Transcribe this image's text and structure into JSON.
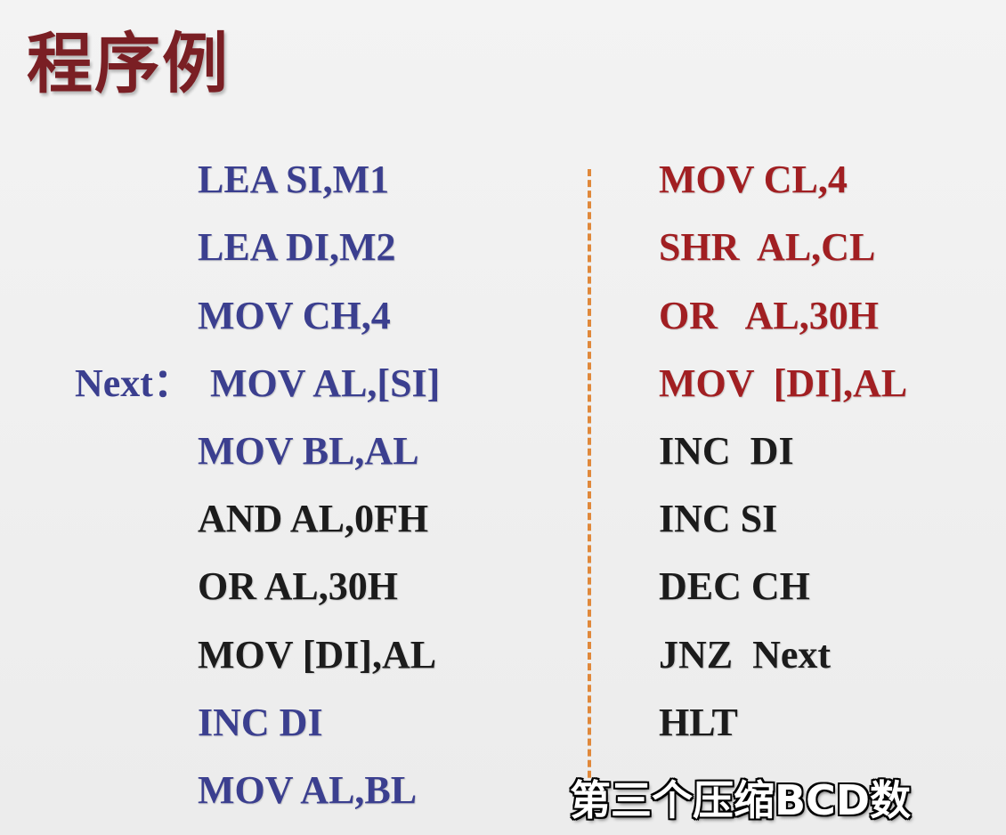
{
  "slide": {
    "title": "程序例",
    "left_column": [
      {
        "text": "LEA SI,M1",
        "color": "blue"
      },
      {
        "text": "LEA DI,M2",
        "color": "blue"
      },
      {
        "text": "MOV CH,4",
        "color": "blue"
      },
      {
        "text": "MOV AL,[SI]",
        "color": "blue"
      },
      {
        "text": "MOV BL,AL",
        "color": "blue"
      },
      {
        "text": "AND AL,0FH",
        "color": "black"
      },
      {
        "text": "OR AL,30H",
        "color": "black"
      },
      {
        "text": "MOV [DI],AL",
        "color": "black"
      },
      {
        "text": "INC DI",
        "color": "blue"
      },
      {
        "text": "MOV AL,BL",
        "color": "blue"
      }
    ],
    "next_label": "Next：",
    "right_column": [
      {
        "text": "MOV CL,4",
        "color": "red"
      },
      {
        "text": "SHR  AL,CL",
        "color": "red"
      },
      {
        "text": "OR   AL,30H",
        "color": "red"
      },
      {
        "text": "MOV  [DI],AL",
        "color": "red"
      },
      {
        "text": "INC  DI",
        "color": "black"
      },
      {
        "text": "INC SI",
        "color": "black"
      },
      {
        "text": "DEC CH",
        "color": "black"
      },
      {
        "text": "JNZ  Next",
        "color": "black"
      },
      {
        "text": "HLT",
        "color": "black"
      }
    ],
    "caption": "第三个压缩BCD数",
    "colors": {
      "title": "#7a1f24",
      "blue": "#3b3f8f",
      "black": "#1c1c1c",
      "red": "#a11f22",
      "divider": "#e0883a"
    }
  }
}
